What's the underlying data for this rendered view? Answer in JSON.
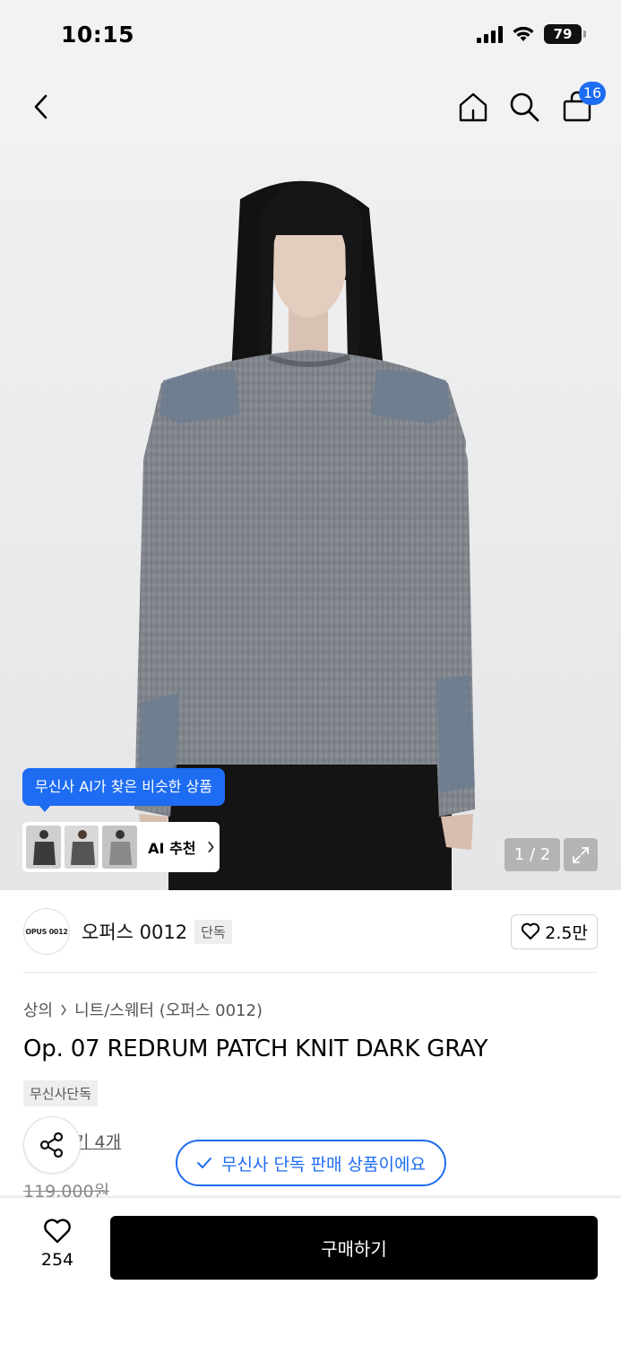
{
  "status_bar": {
    "time": "10:15",
    "battery": "79"
  },
  "nav": {
    "cart_count": "16"
  },
  "gallery": {
    "ai_tooltip": "무신사 AI가 찾은 비슷한 상품",
    "ai_recommend_label": "AI 추천",
    "page_indicator": "1 / 2"
  },
  "brand": {
    "logo_text": "OPUS 0012",
    "name": "오퍼스 0012",
    "tag": "단독",
    "likes": "2.5만"
  },
  "breadcrumb": {
    "category": "상의",
    "subcategory": "니트/스웨터 (오퍼스 0012)"
  },
  "product": {
    "title": "Op. 07 REDRUM PATCH KNIT DARK GRAY",
    "exclusive_tag": "무신사단독",
    "review_link_partial": "기 4개",
    "original_price": "119,000원"
  },
  "exclusive_banner": "무신사 단독 판매 상품이에요",
  "bottom_bar": {
    "wish_count": "254",
    "buy_label": "구매하기"
  },
  "colors": {
    "accent": "#1d6cf2",
    "buy_button": "#000000"
  }
}
